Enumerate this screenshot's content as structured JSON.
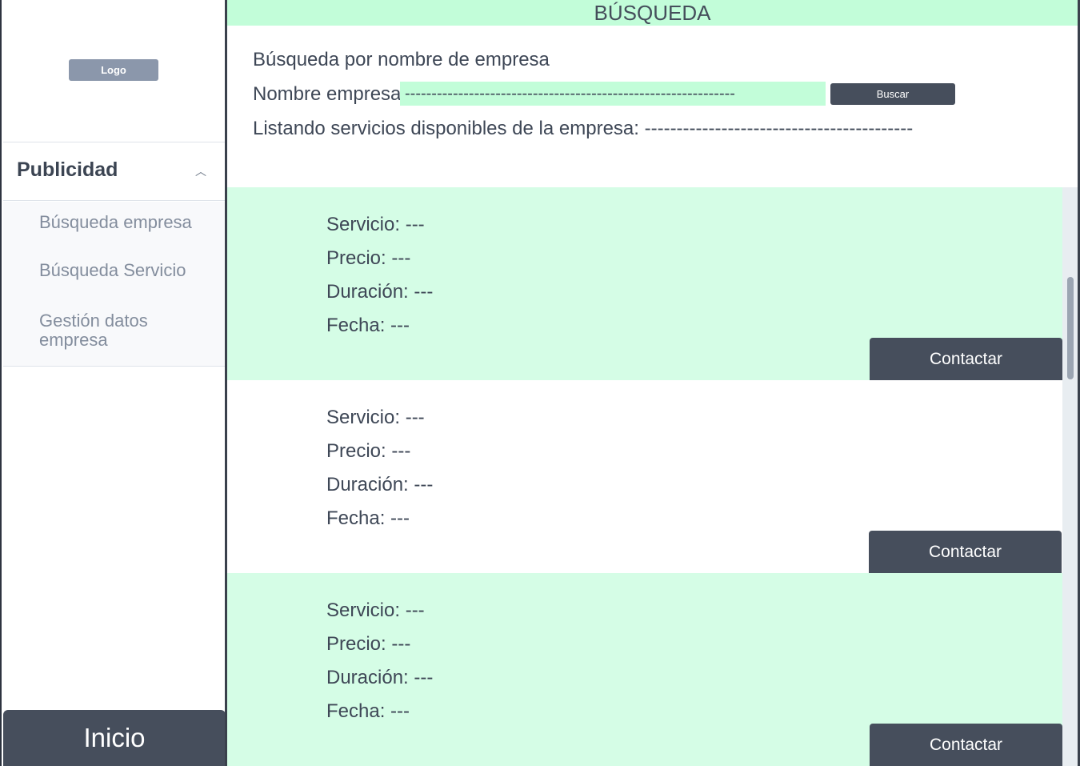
{
  "sidebar": {
    "logo": "Logo",
    "section_title": "Publicidad",
    "items": [
      {
        "label": "Búsqueda empresa"
      },
      {
        "label": "Búsqueda Servicio"
      },
      {
        "label": "Gestión datos empresa"
      }
    ],
    "home_button": "Inicio"
  },
  "main": {
    "banner": "BÚSQUEDA",
    "search_title": "Búsqueda por nombre de empresa",
    "name_label": "Nombre empresa:",
    "name_value": "--------------------------------------------------------------",
    "search_button": "Buscar",
    "listing_text": "Listando servicios disponibles de la empresa: ------------------------------------------",
    "services": [
      {
        "servicio": "Servicio: ---",
        "precio": "Precio: ---",
        "duracion": "Duración: ---",
        "fecha": "Fecha: ---",
        "button": "Contactar"
      },
      {
        "servicio": "Servicio: ---",
        "precio": "Precio: ---",
        "duracion": "Duración: ---",
        "fecha": "Fecha: ---",
        "button": "Contactar"
      },
      {
        "servicio": "Servicio: ---",
        "precio": "Precio: ---",
        "duracion": "Duración: ---",
        "fecha": "Fecha: ---",
        "button": "Contactar"
      }
    ]
  },
  "colors": {
    "accent_green": "#c2fdd9",
    "card_green": "#d5fde6",
    "dark": "#464e5c"
  }
}
